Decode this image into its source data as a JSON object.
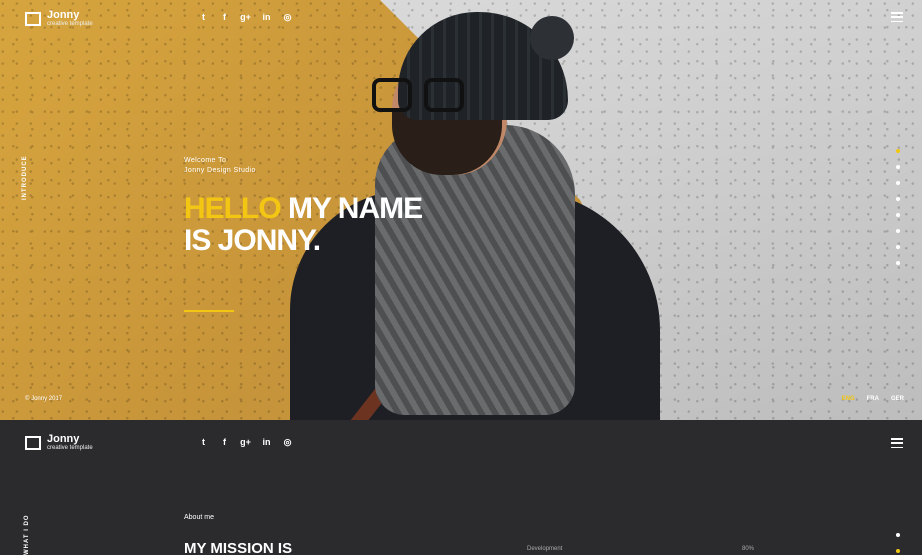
{
  "brand": {
    "name": "Jonny",
    "tagline": "creative template"
  },
  "socials": [
    {
      "icon": "twitter-icon",
      "glyph": "t"
    },
    {
      "icon": "facebook-icon",
      "glyph": "f"
    },
    {
      "icon": "google-plus-icon",
      "glyph": "g+"
    },
    {
      "icon": "linkedin-icon",
      "glyph": "in"
    },
    {
      "icon": "dribbble-icon",
      "glyph": "◎"
    }
  ],
  "hero": {
    "side_label": "INTRODUCE",
    "welcome_line1": "Welcome To",
    "welcome_line2": "Jonny Design Studio",
    "headline_highlight": "HELLO",
    "headline_rest": " MY NAME",
    "headline_line2": "IS JONNY.",
    "copyright": "© Jonny 2017",
    "languages": [
      "ENG",
      "FRA",
      "GER"
    ],
    "active_language": "ENG",
    "pagination_count": 8,
    "active_index": 0
  },
  "section2": {
    "side_label": "WHAT I DO",
    "about_label": "About me",
    "mission_title": "MY MISSION IS",
    "skill": {
      "name": "Development",
      "value": "80%"
    }
  },
  "colors": {
    "accent": "#f3c613",
    "dark": "#2b2b2d"
  }
}
